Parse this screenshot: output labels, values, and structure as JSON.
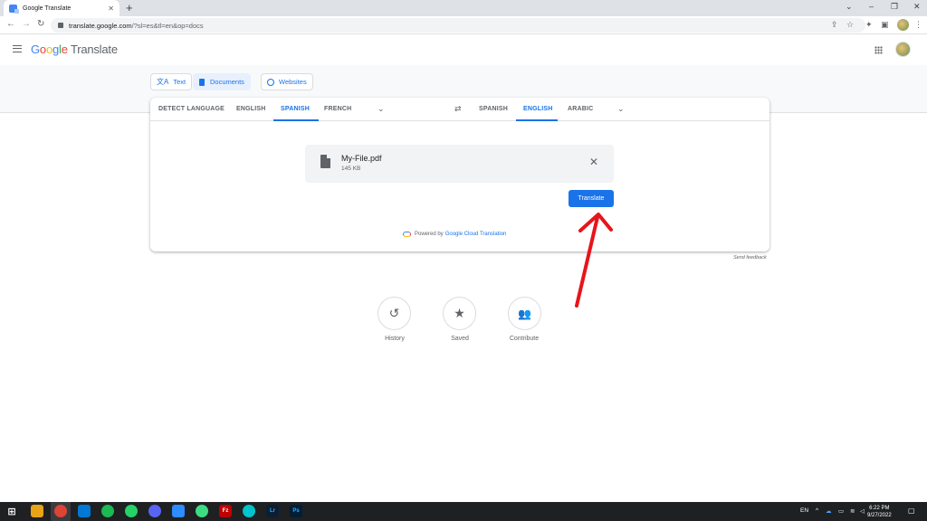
{
  "browser": {
    "tab_title": "Google Translate",
    "tab_close": "✕",
    "new_tab": "+",
    "url_host": "translate.google.com",
    "url_path": "/?sl=es&tl=en&op=docs",
    "window_controls": [
      "⌄",
      "–",
      "❐",
      "✕"
    ]
  },
  "header": {
    "logo_parts": [
      "G",
      "o",
      "o",
      "g",
      "l",
      "e"
    ],
    "product": "Translate"
  },
  "modes": [
    {
      "label": "Text",
      "icon": "translate-icon"
    },
    {
      "label": "Documents",
      "icon": "document-icon"
    },
    {
      "label": "Websites",
      "icon": "globe-icon"
    }
  ],
  "source_langs": [
    "DETECT LANGUAGE",
    "ENGLISH",
    "SPANISH",
    "FRENCH"
  ],
  "target_langs": [
    "SPANISH",
    "ENGLISH",
    "ARABIC"
  ],
  "active_source": "SPANISH",
  "active_target": "ENGLISH",
  "file": {
    "name": "My-File.pdf",
    "size": "145 KB"
  },
  "translate_button": "Translate",
  "powered_by": {
    "prefix": "Powered by",
    "link": "Google Cloud Translation"
  },
  "send_feedback": "Send feedback",
  "actions": [
    {
      "label": "History",
      "icon": "history-icon"
    },
    {
      "label": "Saved",
      "icon": "star-icon"
    },
    {
      "label": "Contribute",
      "icon": "people-icon"
    }
  ],
  "taskbar": {
    "apps": [
      "Fz",
      "Lr",
      "Ps"
    ],
    "lang": "EN",
    "time": "6:22 PM",
    "date": "9/27/2022"
  },
  "colors": {
    "accent": "#1a73e8",
    "annotation_arrow": "#e8141b"
  }
}
